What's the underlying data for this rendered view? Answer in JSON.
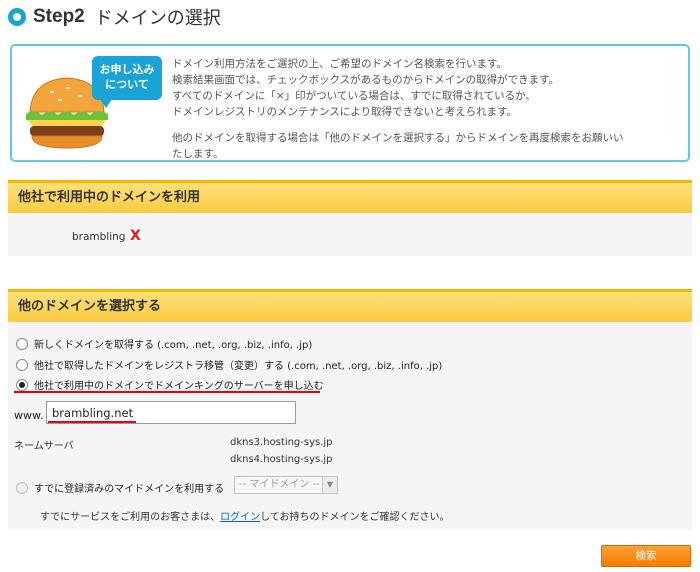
{
  "header": {
    "step": "Step2",
    "title": "ドメインの選択"
  },
  "info": {
    "bubble_lines": [
      "お申し込み",
      "について"
    ],
    "lines": [
      "ドメイン利用方法をご選択の上、ご希望のドメイン名検索を行います。",
      "検索結果画面では、チェックボックスがあるものからドメインの取得ができます。",
      "すべてのドメインに「×」印がついている場合は、すでに取得されているか、",
      "ドメインレジストリのメンテナンスにより取得できないと考えられます。"
    ],
    "note_lines": [
      "他のドメインを取得する場合は「他のドメインを選択する」からドメインを再度検索をお願いい",
      "たします。"
    ]
  },
  "section1": {
    "title": "他社で利用中のドメインを利用",
    "domain": "brambling",
    "status_mark": "X"
  },
  "section2": {
    "title": "他のドメインを選択する",
    "options": [
      {
        "label": "新しくドメインを取得する (.com, .net, .org, .biz, .info, .jp)",
        "checked": false
      },
      {
        "label": "他社で取得したドメインをレジストラ移管（変更）する (.com, .net, .org, .biz, .info, .jp)",
        "checked": false
      },
      {
        "label": "他社で利用中のドメインでドメインキングのサーバーを申し込む",
        "checked": true
      }
    ],
    "www_prefix": "www.",
    "domain_value": "brambling.net",
    "nameserver_label": "ネームサーバ",
    "nameservers": [
      "dkns3.hosting-sys.jp",
      "dkns4.hosting-sys.jp"
    ],
    "my_domain_option": "すでに登録済みのマイドメインを利用する",
    "my_domain_select": "-- マイドメイン --",
    "help_prefix": "すでにサービスをご利用のお客さまは、",
    "help_link": "ログイン",
    "help_suffix": "してお持ちのドメインをご確認ください。"
  },
  "search_button": "検索",
  "colors": {
    "accent_blue": "#1aa3d6",
    "section_yellow": "#fbcb3f",
    "button_orange": "#f57c00",
    "highlight_red": "#e0001b"
  }
}
